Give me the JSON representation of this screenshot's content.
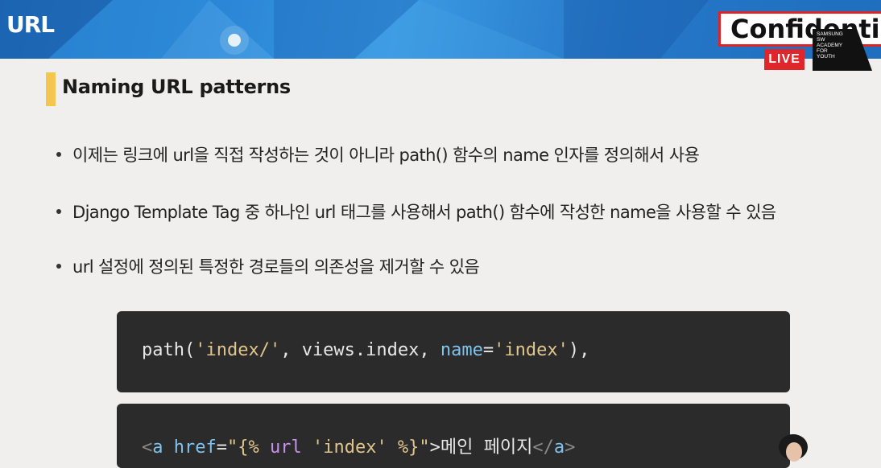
{
  "header": {
    "title": "URL",
    "confidential_label": "Confidential",
    "live_badge": "LIVE",
    "logo_lines": [
      "SAMSUNG",
      "SW",
      "ACADEMY",
      "FOR",
      "YOUTH"
    ]
  },
  "section": {
    "heading": "Naming URL patterns"
  },
  "bullets": [
    "이제는 링크에 url을 직접 작성하는 것이 아니라 path() 함수의 name 인자를 정의해서 사용",
    "Django Template Tag 중 하나인 url 태그를 사용해서 path() 함수에 작성한 name을 사용할 수 있음",
    "url 설정에 정의된 특정한 경로들의 의존성을 제거할 수 있음"
  ],
  "code_blocks": [
    {
      "tokens": {
        "t1": "path(",
        "t2": "'index/'",
        "t3": ", views.index, ",
        "t4": "name",
        "t5": "=",
        "t6": "'index'",
        "t7": "),"
      }
    },
    {
      "tokens": {
        "t1": "<",
        "t2": "a",
        "t3": " href",
        "t4": "=",
        "t5": "\"{%",
        "t6": " url ",
        "t7": "'index'",
        "t8": " %}\"",
        "t9": ">메인 페이지",
        "t10": "</",
        "t11": "a",
        "t12": ">"
      }
    }
  ],
  "colors": {
    "banner": "#2a86d6",
    "accent_bar": "#f4c64f",
    "live": "#e0262b",
    "code_bg": "#2b2b2b"
  }
}
